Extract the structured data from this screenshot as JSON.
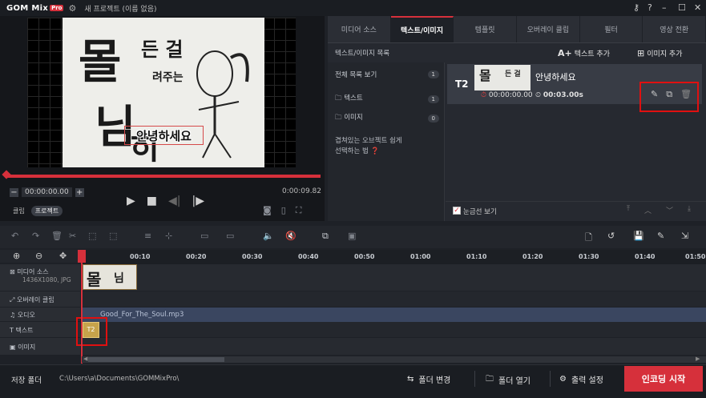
{
  "app": {
    "logo_text": "GOM Mix",
    "logo_badge": "Pro",
    "project_title": "새 프로젝트 (이름 없음)",
    "window_icons": [
      "key-icon",
      "help-icon",
      "minimize-icon",
      "maximize-icon",
      "close-icon"
    ],
    "accent_color": "#d6303b"
  },
  "preview": {
    "overlay_text": "안녕하세요",
    "calligraphy": [
      "몰",
      "든 걸",
      "려주는",
      "님",
      "히"
    ],
    "timecode": "00:00:00.00",
    "duration": "0:00:09.82",
    "minus_label": "−",
    "plus_label": "+",
    "clip_tab": "클립",
    "project_tab": "프로젝트"
  },
  "tabs": [
    "미디어 소스",
    "텍스트/이미지",
    "템플릿",
    "오버레이 클립",
    "필터",
    "영상 전환"
  ],
  "active_tab_index": 1,
  "text_image": {
    "list_header": "텍스트/이미지 목록",
    "add_text_label": "텍스트 추가",
    "add_image_label": "이미지 추가",
    "sidebar": [
      {
        "label": "전체 목록 보기",
        "count": "1"
      },
      {
        "label": "텍스트",
        "count": "1"
      },
      {
        "label": "이미지",
        "count": "0"
      }
    ],
    "tip_line1": "겹쳐있는 오브젝트 쉽게",
    "tip_line2": "선택하는 법",
    "item": {
      "badge": "T2",
      "title": "안녕하세요",
      "start_time": "00:00:00.00",
      "duration": "00:03.00s"
    },
    "gridline_label": "눈금선 보기",
    "gridline_checked": true
  },
  "timeline": {
    "ruler_ticks": [
      "00:10",
      "00:20",
      "00:30",
      "00:40",
      "00:50",
      "01:00",
      "01:10",
      "01:20",
      "01:30",
      "01:40",
      "01:50"
    ],
    "tracks": [
      {
        "label": "미디어 소스",
        "sub": "1436X1080, JPG"
      },
      {
        "label": "오버레이 클립"
      },
      {
        "label": "오디오"
      },
      {
        "label": "텍스트"
      },
      {
        "label": "이미지"
      }
    ],
    "audio_clip": "Good_For_The_Soul.mp3",
    "text_clip": "T2"
  },
  "status": {
    "save_folder_label": "저장 폴더",
    "save_path": "C:\\Users\\a\\Documents\\GOMMixPro\\",
    "change_folder": "폴더 변경",
    "open_folder": "폴더 열기",
    "output_settings": "출력 설정",
    "encode": "인코딩 시작"
  }
}
